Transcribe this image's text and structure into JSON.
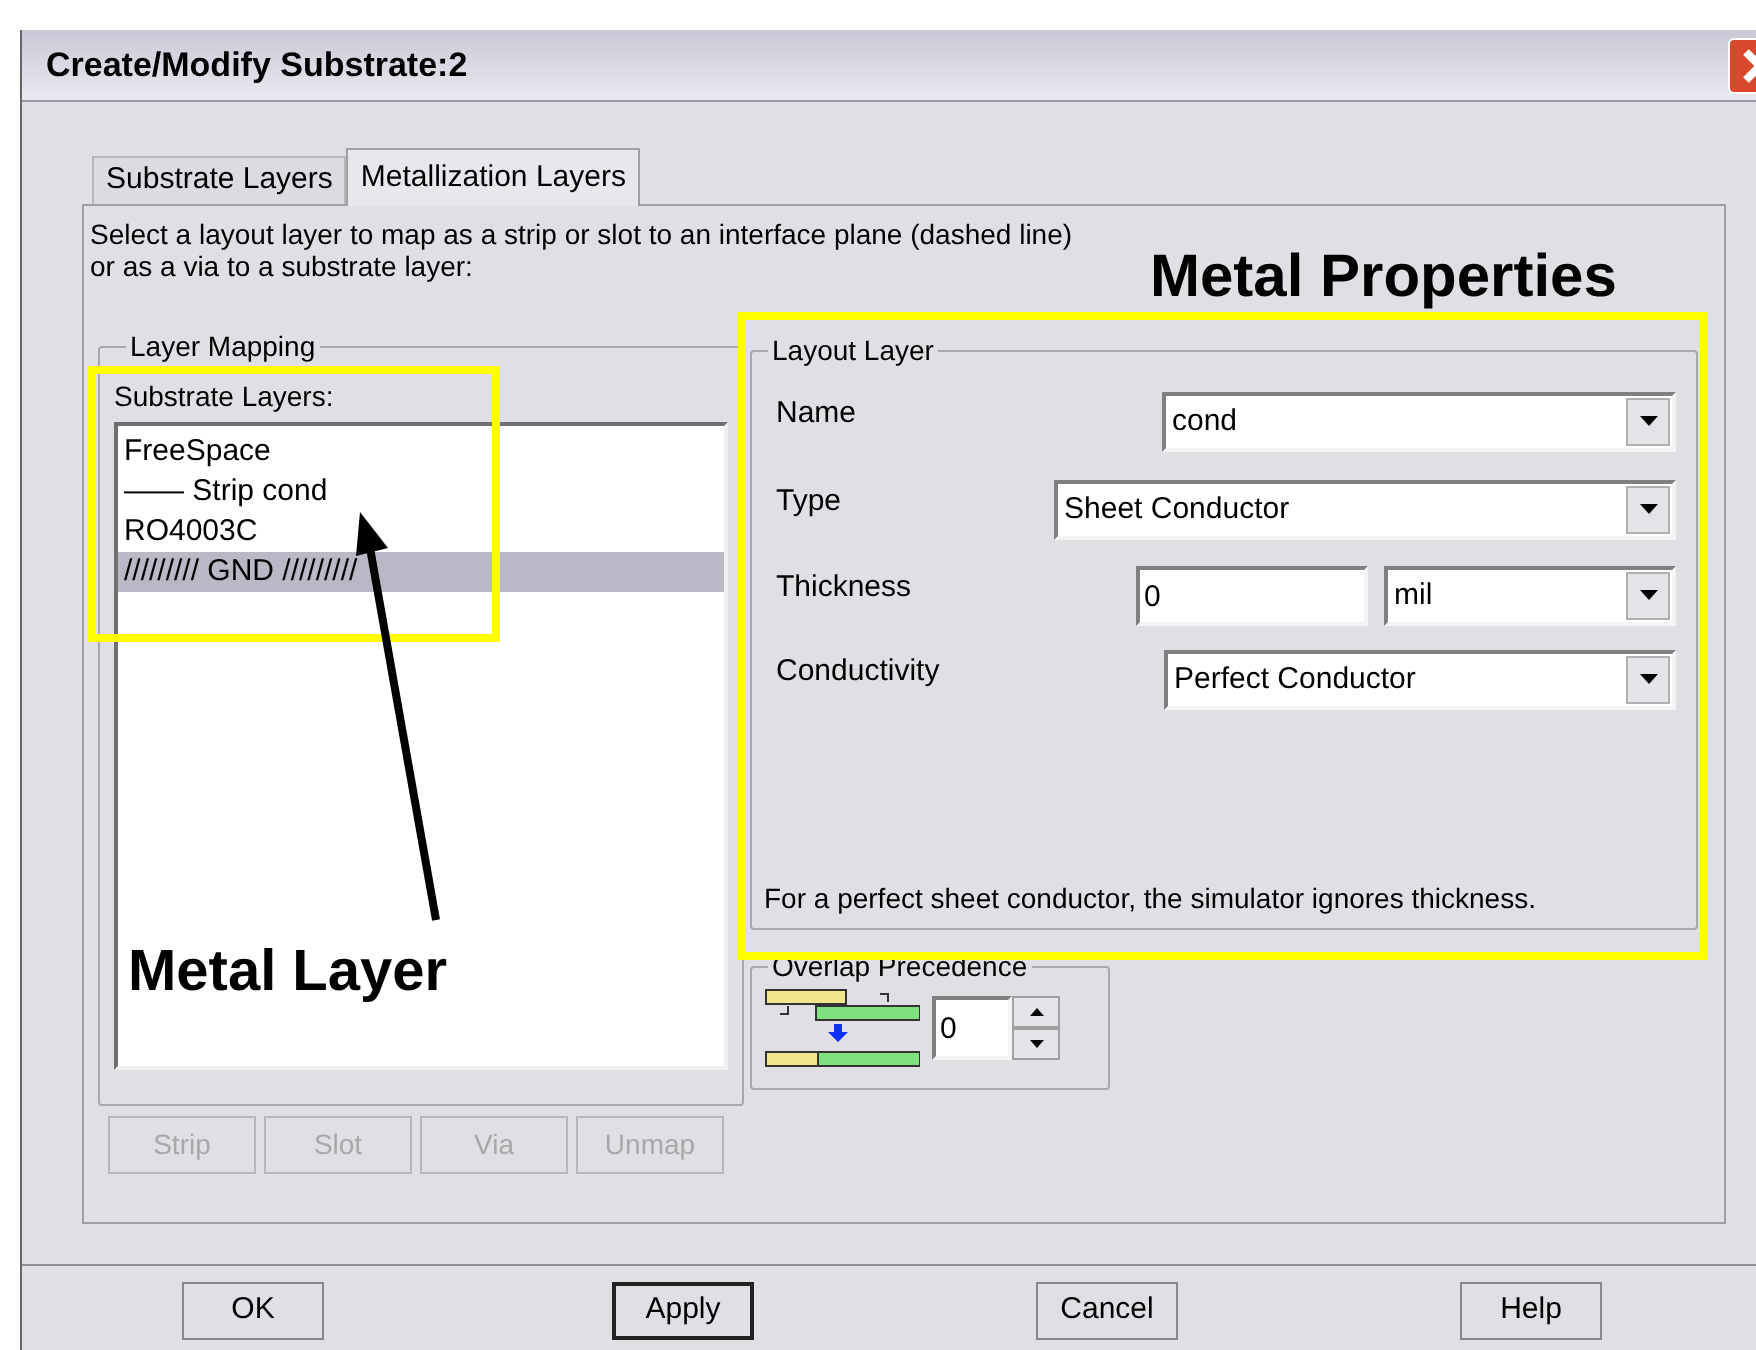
{
  "window": {
    "title": "Create/Modify Substrate:2"
  },
  "tabs": [
    {
      "label": "Substrate Layers",
      "selected": false
    },
    {
      "label": "Metallization Layers",
      "selected": true
    }
  ],
  "instruction": "Select a layout layer to map as a strip or slot to an interface plane (dashed line)\nor as a via to a substrate layer:",
  "layer_mapping": {
    "title": "Layer Mapping",
    "list_label": "Substrate Layers:",
    "items": [
      {
        "text": "FreeSpace",
        "selected": false
      },
      {
        "text": "—— Strip cond",
        "selected": false
      },
      {
        "text": "RO4003C",
        "selected": false
      },
      {
        "text": "///////// GND /////////",
        "selected": true
      }
    ],
    "buttons": [
      {
        "label": "Strip",
        "disabled": true
      },
      {
        "label": "Slot",
        "disabled": true
      },
      {
        "label": "Via",
        "disabled": true
      },
      {
        "label": "Unmap",
        "disabled": true
      }
    ]
  },
  "layout_layer": {
    "title": "Layout Layer",
    "name": {
      "label": "Name",
      "value": "cond"
    },
    "type": {
      "label": "Type",
      "value": "Sheet Conductor"
    },
    "thickness": {
      "label": "Thickness",
      "value": "0",
      "unit": "mil"
    },
    "conductivity": {
      "label": "Conductivity",
      "value": "Perfect Conductor"
    },
    "note": "For a perfect sheet conductor, the simulator ignores thickness."
  },
  "overlap_precedence": {
    "title": "Overlap Precedence",
    "value": "0"
  },
  "buttons": [
    {
      "label": "OK",
      "default": false
    },
    {
      "label": "Apply",
      "default": true
    },
    {
      "label": "Cancel",
      "default": false
    },
    {
      "label": "Help",
      "default": false
    }
  ],
  "annotations": {
    "heading": "Metal Properties",
    "label": "Metal Layer"
  }
}
